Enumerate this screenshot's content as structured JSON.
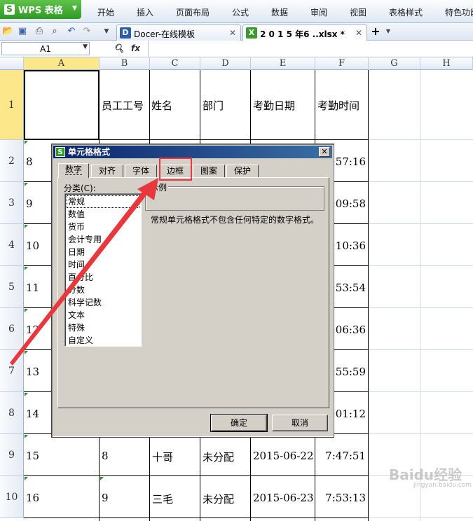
{
  "app": {
    "name": "WPS 表格"
  },
  "menu": [
    "开始",
    "插入",
    "页面布局",
    "公式",
    "数据",
    "审阅",
    "视图",
    "表格样式",
    "特色功能"
  ],
  "doc_tabs": [
    {
      "label": "Docer-在线模板",
      "icon": "docer-icon"
    },
    {
      "label": "2 0 1 5 年6 ..xlsx *",
      "icon": "xlsx-icon"
    }
  ],
  "formula_bar": {
    "name_box": "A1",
    "fx_label": "fx"
  },
  "columns": [
    "A",
    "B",
    "C",
    "D",
    "E",
    "F",
    "G",
    "H"
  ],
  "rows": [
    "1",
    "2",
    "3",
    "4",
    "5",
    "6",
    "7",
    "8",
    "9",
    "10"
  ],
  "header_row": [
    "",
    "员工工号",
    "姓名",
    "部门",
    "考勤日期",
    "考勤时间"
  ],
  "cells": {
    "a": [
      "8",
      "9",
      "10",
      "11",
      "12",
      "13",
      "14",
      "15",
      "16"
    ],
    "f_partial": [
      ":57:16",
      ":09:58",
      ":10:36",
      ":53:54",
      ":06:36",
      ":55:59",
      ":01:12"
    ],
    "row9": [
      "15",
      "8",
      "十哥",
      "未分配",
      "2015-06-22",
      "7:47:51"
    ],
    "row10": [
      "16",
      "9",
      "三毛",
      "未分配",
      "2015-06-23",
      "7:53:13"
    ]
  },
  "dialog": {
    "title": "单元格格式",
    "tabs": [
      "数字",
      "对齐",
      "字体",
      "边框",
      "图案",
      "保护"
    ],
    "active_tab": "数字",
    "category_label": "分类(C):",
    "categories": [
      "常规",
      "数值",
      "货币",
      "会计专用",
      "日期",
      "时间",
      "百分比",
      "分数",
      "科学记数",
      "文本",
      "特殊",
      "自定义"
    ],
    "selected_category": "常规",
    "sample_label": "示例",
    "description": "常规单元格格式不包含任何特定的数字格式。",
    "ok": "确定",
    "cancel": "取消"
  },
  "watermark": {
    "main": "Baidu经验",
    "sub": "jingyan.baidu.com"
  },
  "colors": {
    "highlight": "#e8383d",
    "title_bar": "#0a246a",
    "selected_header": "#fce78a"
  }
}
